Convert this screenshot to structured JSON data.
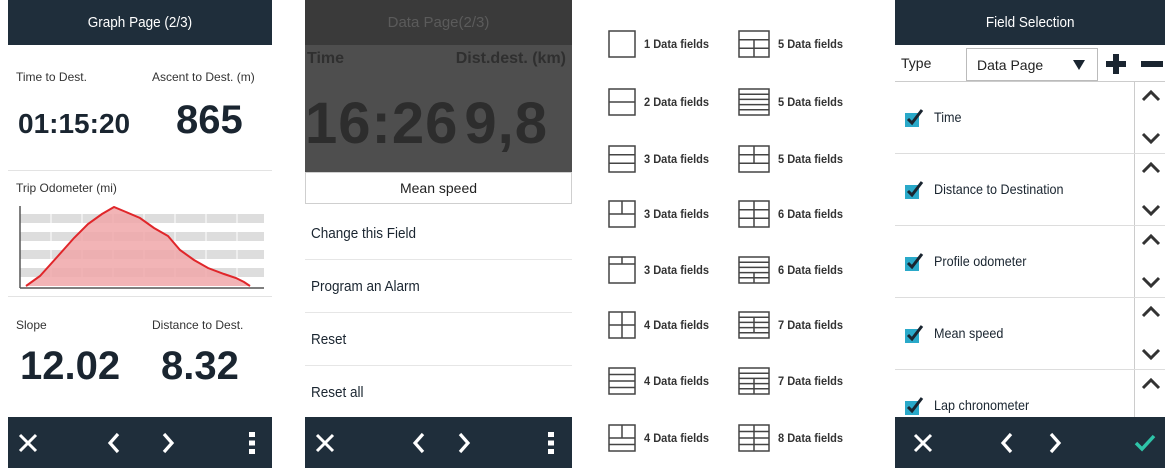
{
  "graph_page": {
    "title": "Graph Page (2/3)",
    "time_to_dest_label": "Time to Dest.",
    "time_to_dest_value": "01:15:20",
    "ascent_label": "Ascent to Dest. (m)",
    "ascent_value": "865",
    "trip_odometer_label": "Trip Odometer (mi)",
    "slope_label": "Slope",
    "slope_value": "12.02",
    "distance_label": "Distance to Dest.",
    "distance_value": "8.32"
  },
  "data_page": {
    "title": "Data Page(2/3)",
    "time_label": "Time",
    "dist_label": "Dist.dest. (km)",
    "time_value": "16:26",
    "dist_value": "9,8",
    "field_name": "Mean speed",
    "menu": [
      "Change this Field",
      "Program an Alarm",
      "Reset",
      "Reset all"
    ]
  },
  "layouts": {
    "left": [
      "1 Data fields",
      "2 Data fields",
      "3 Data fields",
      "3 Data fields",
      "3 Data fields",
      "4 Data fields",
      "4 Data fields",
      "4 Data fields"
    ],
    "right": [
      "5 Data fields",
      "5 Data fields",
      "5 Data fields",
      "6 Data fields",
      "6 Data fields",
      "7 Data fields",
      "7 Data fields",
      "8 Data fields"
    ]
  },
  "field_selection": {
    "title": "Field Selection",
    "type_label": "Type",
    "type_value": "Data Page",
    "fields": [
      "Time",
      "Distance to Destination",
      "Profile odometer",
      "Mean speed",
      "Lap chronometer"
    ]
  },
  "colors": {
    "header_bg": "#1f2e3b",
    "accent_check": "#2aa9c9",
    "graph_fill": "#f0a7a9",
    "graph_line": "#e0262a",
    "confirm": "#2ec4a8"
  },
  "icons": {
    "close": "close-icon",
    "prev": "chevron-left-icon",
    "next": "chevron-right-icon",
    "menu": "kebab-menu-icon",
    "confirm": "check-icon"
  }
}
